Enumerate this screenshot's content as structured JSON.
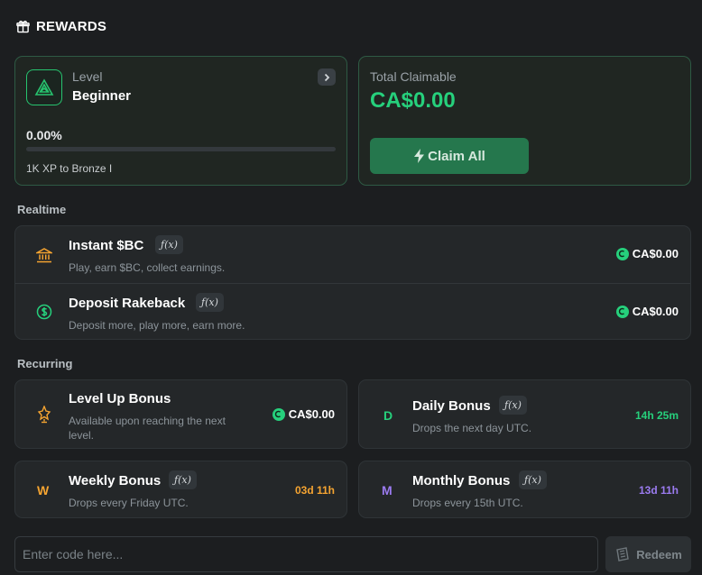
{
  "header": {
    "title": "REWARDS",
    "icon": "gift-icon"
  },
  "level": {
    "label": "Level",
    "name": "Beginner",
    "progress_text": "0.00%",
    "progress": 0.0,
    "xp_text": "1K XP to Bronze I",
    "accent": "#27c46f"
  },
  "claim": {
    "label": "Total Claimable",
    "amount": "CA$0.00",
    "button_label": "Claim All",
    "button_icon": "lightning-icon"
  },
  "realtime": {
    "title": "Realtime",
    "items": [
      {
        "title": "Instant $BC",
        "fx": "ƒ(x)",
        "subtitle": "Play, earn $BC, collect earnings.",
        "amount": "CA$0.00",
        "icon": "bank-icon"
      },
      {
        "title": "Deposit Rakeback",
        "fx": "ƒ(x)",
        "subtitle": "Deposit more, play more, earn more.",
        "amount": "CA$0.00",
        "icon": "dollar-circle-icon"
      }
    ]
  },
  "recurring": {
    "title": "Recurring",
    "level_up": {
      "title": "Level Up Bonus",
      "subtitle": "Available upon reaching the next level.",
      "amount": "CA$0.00",
      "icon": "trophy-icon"
    },
    "daily": {
      "letter": "D",
      "title": "Daily Bonus",
      "fx": "ƒ(x)",
      "subtitle": "Drops the next day UTC.",
      "timer": "14h 25m",
      "color": "#26d07c"
    },
    "weekly": {
      "letter": "W",
      "title": "Weekly Bonus",
      "fx": "ƒ(x)",
      "subtitle": "Drops every Friday UTC.",
      "timer": "03d 11h",
      "color": "#f5a431"
    },
    "monthly": {
      "letter": "M",
      "title": "Monthly Bonus",
      "fx": "ƒ(x)",
      "subtitle": "Drops every 15th UTC.",
      "timer": "13d 11h",
      "color": "#9b7bf0"
    }
  },
  "redeem": {
    "placeholder": "Enter code here...",
    "button_label": "Redeem",
    "button_icon": "ticket-icon"
  }
}
